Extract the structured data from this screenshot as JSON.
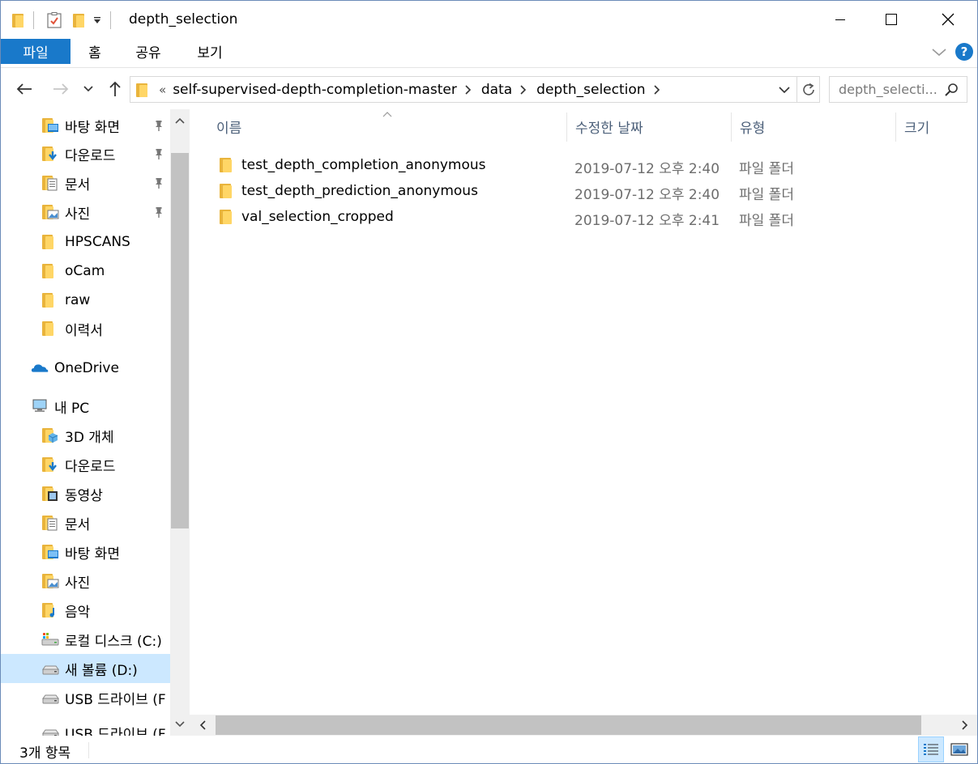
{
  "window": {
    "title": "depth_selection",
    "controls": {
      "minimize": "—",
      "maximize": "☐",
      "close": "✕"
    }
  },
  "ribbon": {
    "tabs": [
      {
        "label": "파일",
        "active": true
      },
      {
        "label": "홈"
      },
      {
        "label": "공유"
      },
      {
        "label": "보기"
      }
    ],
    "help": "?"
  },
  "address": {
    "overflow": "«",
    "crumbs": [
      "self-supervised-depth-completion-master",
      "data",
      "depth_selection"
    ],
    "search_placeholder": "depth_selecti..."
  },
  "nav": {
    "quick_access": [
      {
        "label": "바탕 화면",
        "icon": "desktop-folder-icon",
        "pinned": true
      },
      {
        "label": "다운로드",
        "icon": "downloads-folder-icon",
        "pinned": true
      },
      {
        "label": "문서",
        "icon": "documents-folder-icon",
        "pinned": true
      },
      {
        "label": "사진",
        "icon": "pictures-folder-icon",
        "pinned": true
      },
      {
        "label": "HPSCANS",
        "icon": "folder-icon"
      },
      {
        "label": "oCam",
        "icon": "folder-icon"
      },
      {
        "label": "raw",
        "icon": "folder-icon"
      },
      {
        "label": "이력서",
        "icon": "folder-icon"
      }
    ],
    "onedrive": "OneDrive",
    "this_pc": "내 PC",
    "pc_items": [
      {
        "label": "3D 개체",
        "icon": "3d-objects-icon"
      },
      {
        "label": "다운로드",
        "icon": "downloads-folder-icon"
      },
      {
        "label": "동영상",
        "icon": "videos-folder-icon"
      },
      {
        "label": "문서",
        "icon": "documents-folder-icon"
      },
      {
        "label": "바탕 화면",
        "icon": "desktop-folder-icon"
      },
      {
        "label": "사진",
        "icon": "pictures-folder-icon"
      },
      {
        "label": "음악",
        "icon": "music-folder-icon"
      },
      {
        "label": "로컬 디스크 (C:)",
        "icon": "local-disk-icon"
      },
      {
        "label": "새 볼륨 (D:)",
        "icon": "drive-icon",
        "selected": true
      },
      {
        "label": "USB 드라이브 (F",
        "icon": "usb-drive-icon"
      },
      {
        "label": "USB 드라이브 (F",
        "icon": "usb-drive-icon"
      }
    ]
  },
  "columns": {
    "name": "이름",
    "modified": "수정한 날짜",
    "type": "유형",
    "size": "크기"
  },
  "files": [
    {
      "name": "test_depth_completion_anonymous",
      "modified": "2019-07-12 오후 2:40",
      "type": "파일 폴더"
    },
    {
      "name": "test_depth_prediction_anonymous",
      "modified": "2019-07-12 오후 2:40",
      "type": "파일 폴더"
    },
    {
      "name": "val_selection_cropped",
      "modified": "2019-07-12 오후 2:41",
      "type": "파일 폴더"
    }
  ],
  "status": {
    "item_count": "3개 항목"
  },
  "colors": {
    "accent": "#1979ca",
    "selection": "#cce8ff",
    "folder": "#ffd666"
  }
}
